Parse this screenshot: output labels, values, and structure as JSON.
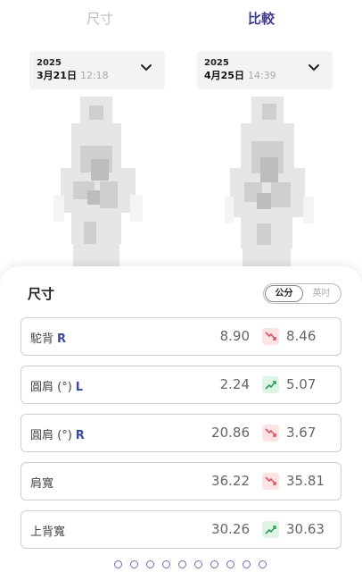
{
  "tabs": {
    "size": "尺寸",
    "compare": "比較"
  },
  "left_date": {
    "year": "2025",
    "day": "3月21日",
    "time": "12:18"
  },
  "right_date": {
    "year": "2025",
    "day": "4月25日",
    "time": "14:39"
  },
  "section": {
    "title": "尺寸"
  },
  "unit_toggle": {
    "cm": "公分",
    "inch": "英吋",
    "selected": "公分"
  },
  "colors": {
    "accent": "#3d3b8e",
    "side_label": "#3b4a9e",
    "down": "#d9535f",
    "up": "#2f9d56"
  },
  "measurements": [
    {
      "label": "駝背",
      "side": "R",
      "before": "8.90",
      "trend": "down",
      "after": "8.46"
    },
    {
      "label": "圓肩 (°)",
      "side": "L",
      "before": "2.24",
      "trend": "up",
      "after": "5.07"
    },
    {
      "label": "圓肩 (°)",
      "side": "R",
      "before": "20.86",
      "trend": "down",
      "after": "3.67"
    },
    {
      "label": "肩寬",
      "side": "",
      "before": "36.22",
      "trend": "down",
      "after": "35.81"
    },
    {
      "label": "上背寬",
      "side": "",
      "before": "30.26",
      "trend": "up",
      "after": "30.63"
    }
  ],
  "pager": {
    "count": 10
  }
}
